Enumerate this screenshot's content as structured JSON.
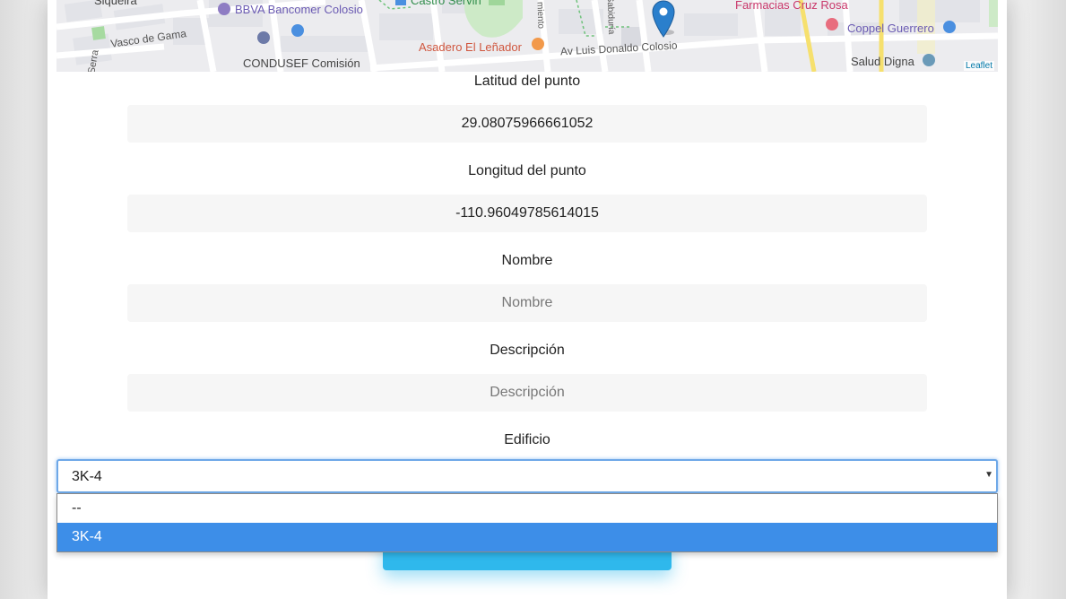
{
  "map": {
    "labels": {
      "siqueira": "Siqueira",
      "bbva": "BBVA Bancomer Colosio",
      "castro_servin": "Castro Servin",
      "farmacias": "Farmacias Cruz Rosa",
      "vasco_de_gama": "Vasco de Gama",
      "asadero": "Asadero El Leñador",
      "av_colosio": "Av Luis Donaldo Colosio",
      "coppel": "Coppel Guerrero",
      "condusef": "CONDUSEF Comisión",
      "salud_digna": "Salud Digna",
      "serra": "Serra",
      "saldanha": "Saldanha",
      "sabiduria": "Sabiduría",
      "miento": "miento"
    },
    "attribution": "Leaflet"
  },
  "form": {
    "latitude": {
      "label": "Latitud del punto",
      "value": "29.08075966661052"
    },
    "longitude": {
      "label": "Longitud del punto",
      "value": "-110.96049785614015"
    },
    "name": {
      "label": "Nombre",
      "placeholder": "Nombre"
    },
    "description": {
      "label": "Descripción",
      "placeholder": "Descripción"
    },
    "building": {
      "label": "Edificio",
      "selected": "3K-4",
      "options": [
        "--",
        "3K-4"
      ]
    }
  },
  "colors": {
    "accent": "#2fb8ec",
    "selection": "#3d8ee8",
    "focus_ring": "#6ea8e8",
    "input_bg": "#f6f6f6"
  }
}
